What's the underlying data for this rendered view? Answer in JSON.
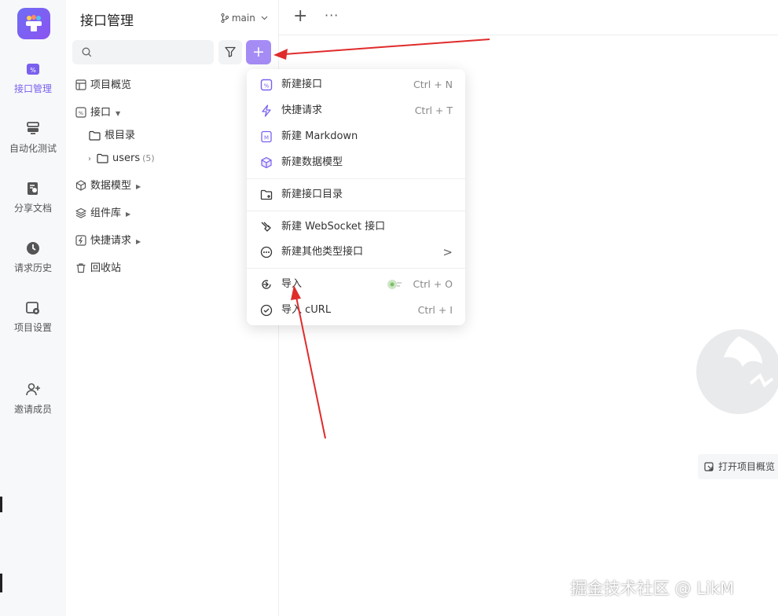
{
  "colors": {
    "accent": "#7a60ee",
    "plus_button": "#a58cf5",
    "arrow": "#e02b2b"
  },
  "nav": {
    "items": [
      {
        "label": "接口管理",
        "icon": "api-icon",
        "active": true
      },
      {
        "label": "自动化测试",
        "icon": "automation-icon"
      },
      {
        "label": "分享文档",
        "icon": "share-doc-icon"
      },
      {
        "label": "请求历史",
        "icon": "history-icon"
      },
      {
        "label": "项目设置",
        "icon": "settings-icon"
      },
      {
        "label": "邀请成员",
        "icon": "invite-member-icon"
      }
    ]
  },
  "sidebar": {
    "title": "接口管理",
    "branch": "main",
    "search_placeholder": "",
    "plus_label": "+",
    "tree": {
      "overview": "项目概览",
      "api": "接口",
      "root": "根目录",
      "users": "users",
      "users_count": "(5)",
      "models": "数据模型",
      "components": "组件库",
      "quick": "快捷请求",
      "trash": "回收站"
    }
  },
  "topbar": {
    "plus": "+",
    "more": "···"
  },
  "menu": {
    "items": [
      {
        "label": "新建接口",
        "shortcut": "Ctrl + N",
        "icon": "api-icon"
      },
      {
        "label": "快捷请求",
        "shortcut": "Ctrl + T",
        "icon": "lightning-icon"
      },
      {
        "label": "新建 Markdown",
        "shortcut": "",
        "icon": "markdown-icon"
      },
      {
        "label": "新建数据模型",
        "shortcut": "",
        "icon": "cube-icon"
      },
      {
        "label": "新建接口目录",
        "shortcut": "",
        "icon": "folder-plus-icon"
      },
      {
        "label": "新建 WebSocket 接口",
        "shortcut": "",
        "icon": "websocket-icon"
      },
      {
        "label": "新建其他类型接口",
        "shortcut": "",
        "icon": "more-circle-icon",
        "submenu": ">"
      },
      {
        "label": "导入",
        "shortcut": "Ctrl + O",
        "icon": "import-icon"
      },
      {
        "label": "导入 cURL",
        "shortcut": "Ctrl + I",
        "icon": "curl-icon"
      }
    ]
  },
  "main": {
    "open_overview": "打开项目概览"
  },
  "watermark": "掘金技术社区 @ LikM"
}
